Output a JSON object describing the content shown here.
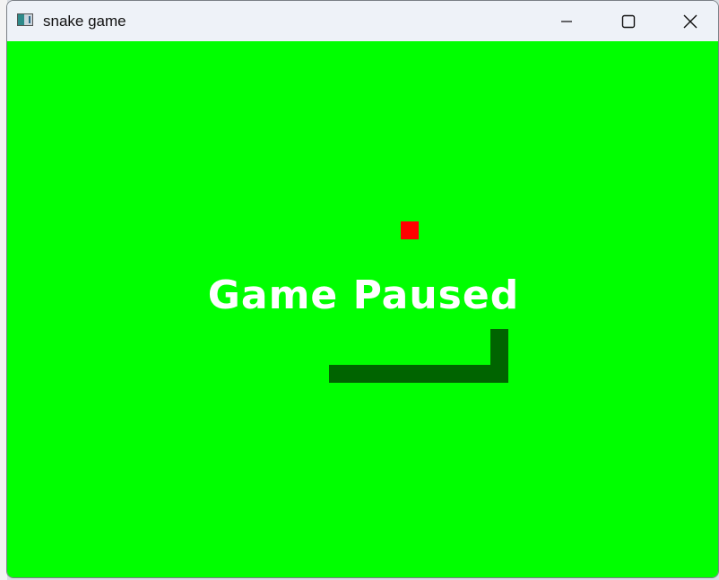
{
  "window": {
    "title": "snake game",
    "icon": "app-window-icon",
    "controls": [
      "minimize-icon",
      "maximize-icon",
      "close-icon"
    ]
  },
  "game": {
    "status_text": "Game Paused",
    "colors": {
      "background": "#00ff00",
      "snake": "#006400",
      "food": "#ff0000",
      "text": "#ffffff"
    }
  }
}
